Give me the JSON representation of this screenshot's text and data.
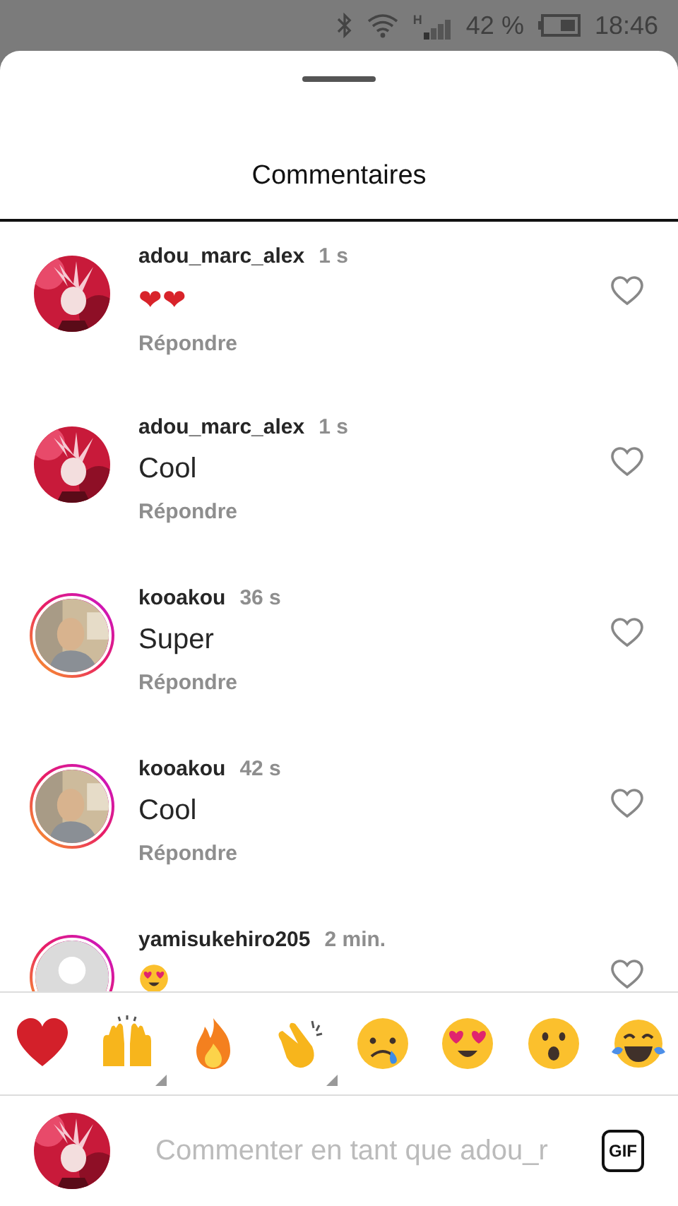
{
  "status_bar": {
    "network": "H",
    "battery": "42 %",
    "time": "18:46"
  },
  "sheet": {
    "title": "Commentaires"
  },
  "comments": [
    {
      "user": "adou_marc_alex",
      "time": "1 s",
      "kind": "emoji",
      "text": "❤❤",
      "reply": "Répondre",
      "story_ring": false
    },
    {
      "user": "adou_marc_alex",
      "time": "1 s",
      "kind": "text",
      "text": "Cool",
      "reply": "Répondre",
      "story_ring": false
    },
    {
      "user": "kooakou",
      "time": "36 s",
      "kind": "text",
      "text": "Super",
      "reply": "Répondre",
      "story_ring": true
    },
    {
      "user": "kooakou",
      "time": "42 s",
      "kind": "text",
      "text": "Cool",
      "reply": "Répondre",
      "story_ring": true
    },
    {
      "user": "yamisukehiro205",
      "time": "2 min.",
      "kind": "heart-eyes",
      "story_ring": true,
      "avatar": {
        "kind": "placeholder"
      }
    }
  ],
  "reactions": [
    {
      "kind": "heart",
      "has_variants": false
    },
    {
      "kind": "raised-hands",
      "has_variants": true
    },
    {
      "kind": "fire",
      "has_variants": false
    },
    {
      "kind": "clap",
      "has_variants": true
    },
    {
      "kind": "crying",
      "has_variants": false
    },
    {
      "kind": "heart-eyes",
      "has_variants": false
    },
    {
      "kind": "surprised",
      "has_variants": false
    },
    {
      "kind": "tears-of-joy",
      "has_variants": false
    }
  ],
  "composer": {
    "placeholder": "Commenter en tant que adou_r",
    "gif_label": "GIF"
  }
}
